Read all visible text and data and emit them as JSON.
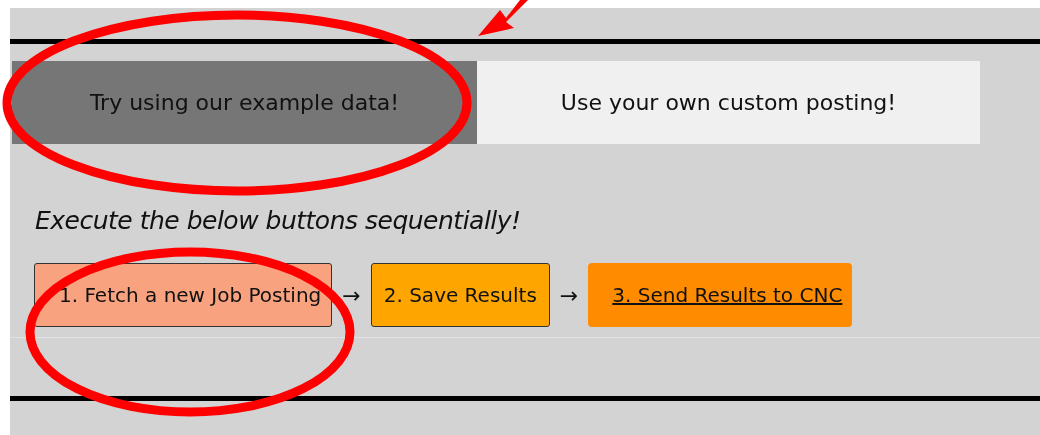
{
  "tabs": [
    {
      "label": "Try using our example data!",
      "selected": true
    },
    {
      "label": "Use your own custom posting!",
      "selected": false
    }
  ],
  "instruction": "Execute the below buttons sequentially!",
  "steps": [
    {
      "label": "1. Fetch a new Job Posting",
      "kind": "button",
      "color": "#f9a27f"
    },
    {
      "label": "2. Save Results",
      "kind": "button",
      "color": "#ffa500"
    },
    {
      "label": "3. Send Results to CNC",
      "kind": "link",
      "color": "#ff8c00"
    }
  ],
  "separator": "→",
  "annotations": [
    {
      "kind": "ellipse"
    },
    {
      "kind": "ellipse"
    },
    {
      "kind": "arrow"
    }
  ]
}
